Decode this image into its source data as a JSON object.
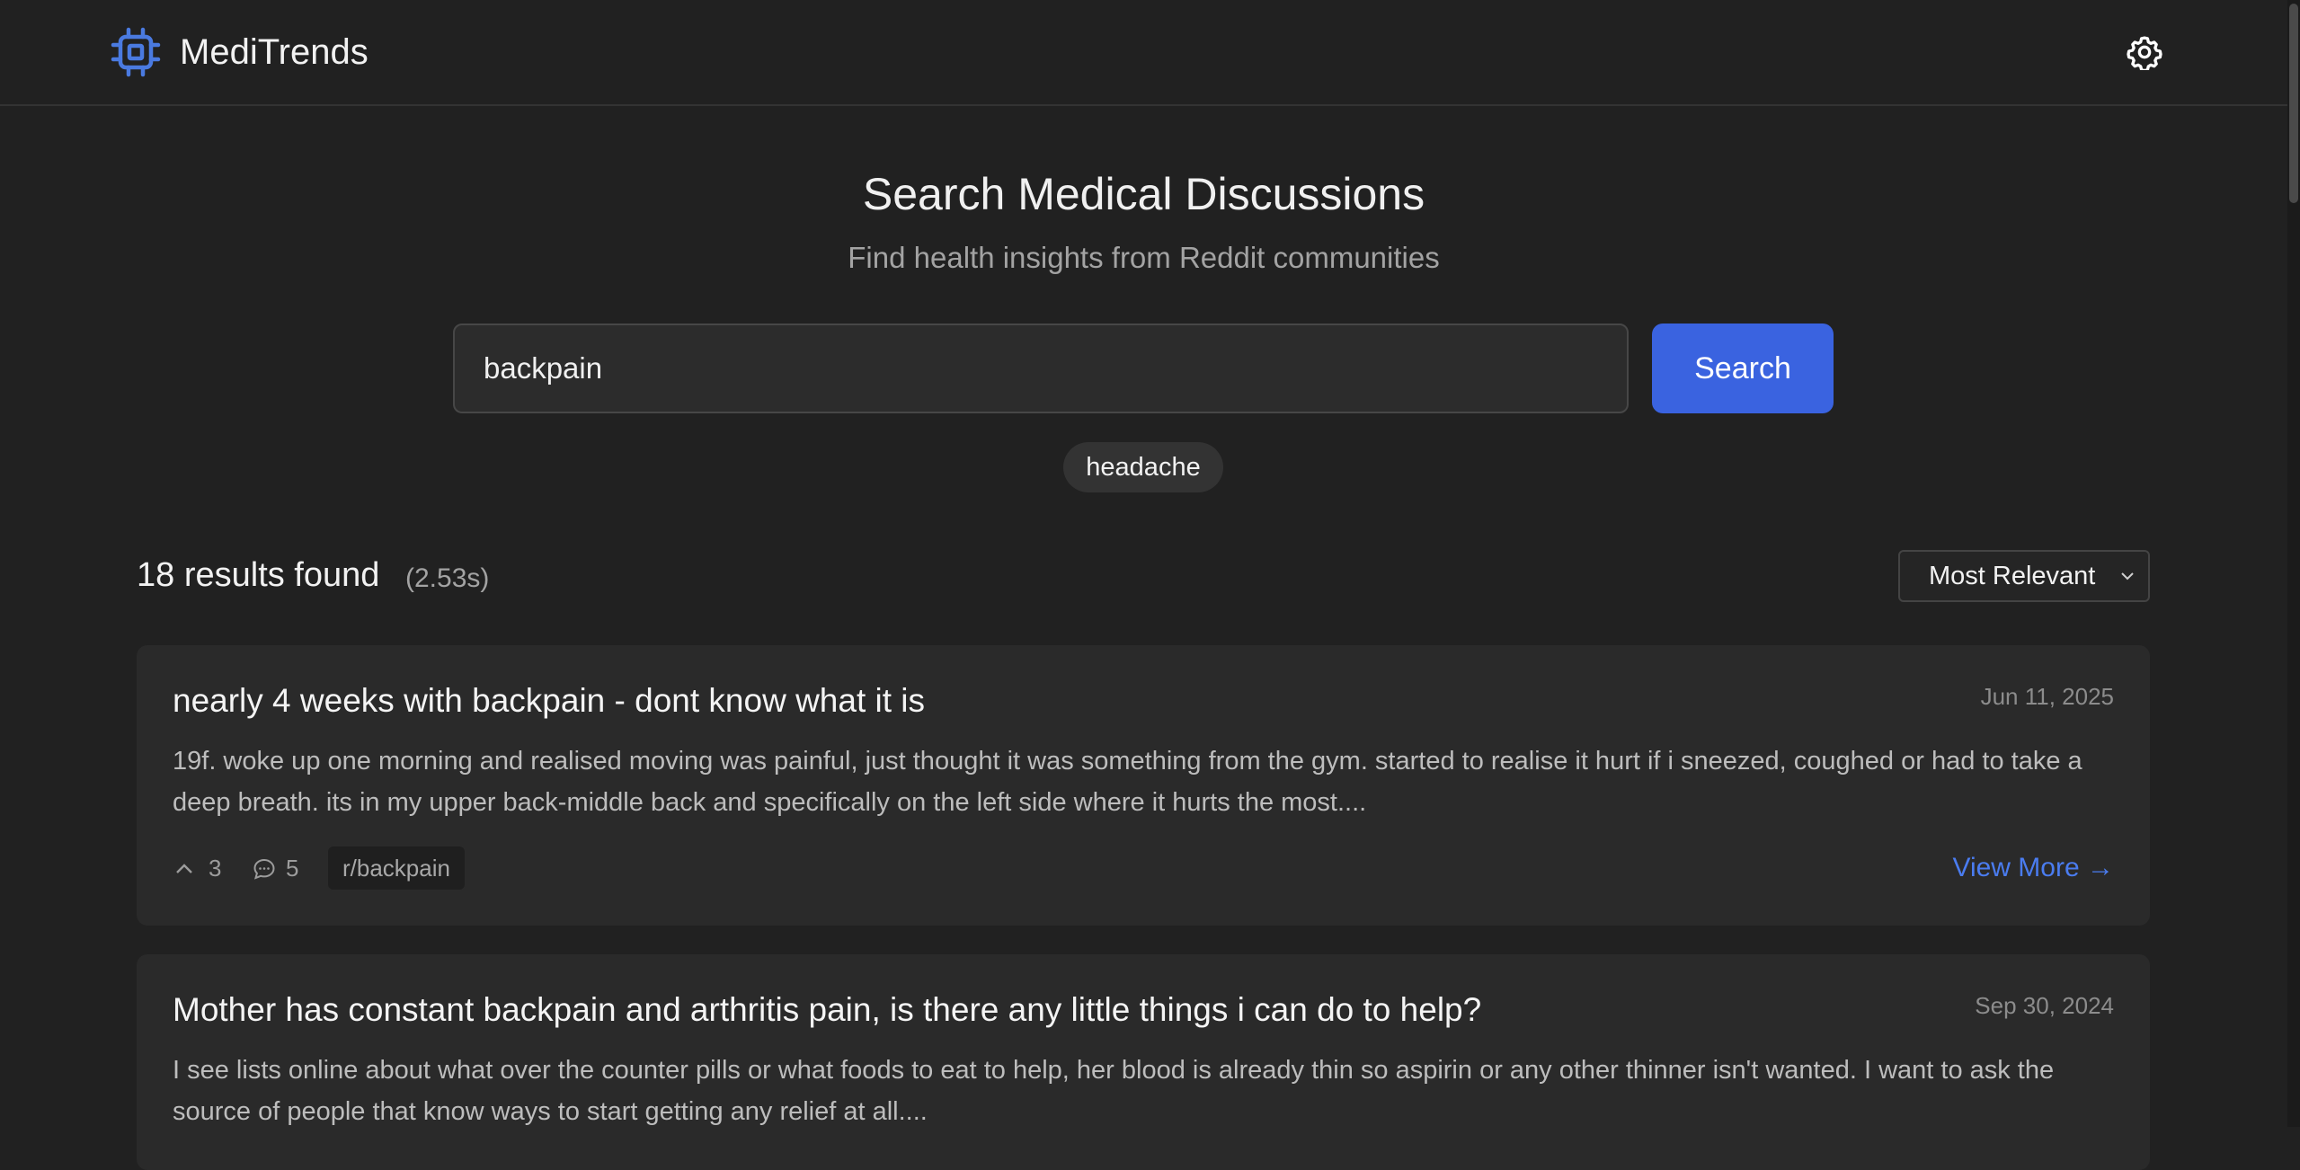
{
  "app": {
    "name": "MediTrends"
  },
  "hero": {
    "title": "Search Medical Discussions",
    "subtitle": "Find health insights from Reddit communities"
  },
  "search": {
    "value": "backpain",
    "button_label": "Search"
  },
  "suggestions": [
    "headache"
  ],
  "results": {
    "count_label": "18 results found",
    "time_label": "(2.53s)",
    "sort": {
      "selected": "Most Relevant"
    },
    "items": [
      {
        "title": "nearly 4 weeks with backpain - dont know what it is",
        "date": "Jun 11, 2025",
        "excerpt": "19f. woke up one morning and realised moving was painful, just thought it was something from the gym. started to realise it hurt if i sneezed, coughed or had to take a deep breath. its in my upper back-middle back and specifically on the left side where it hurts the most....",
        "upvotes": "3",
        "comments": "5",
        "subreddit": "r/backpain",
        "link_label": "View More →"
      },
      {
        "title": "Mother has constant backpain and arthritis pain, is there any little things i can do to help?",
        "date": "Sep 30, 2024",
        "excerpt": "I see lists online about what over the counter pills or what foods to eat to help, her blood is already thin so aspirin or any other thinner isn't wanted. I want to ask the source of people that know ways to start getting any relief at all...."
      }
    ]
  },
  "icons": {
    "logo": "chip-icon",
    "settings": "gear-icon",
    "upvote": "chevron-up-icon",
    "comments": "comment-bubble-icon",
    "sort": "chevron-down-icon"
  },
  "colors": {
    "background": "#212121",
    "card": "#2a2a2a",
    "accent": "#3a63e0",
    "link": "#4a7cf0",
    "logo": "#4a7ae0"
  }
}
